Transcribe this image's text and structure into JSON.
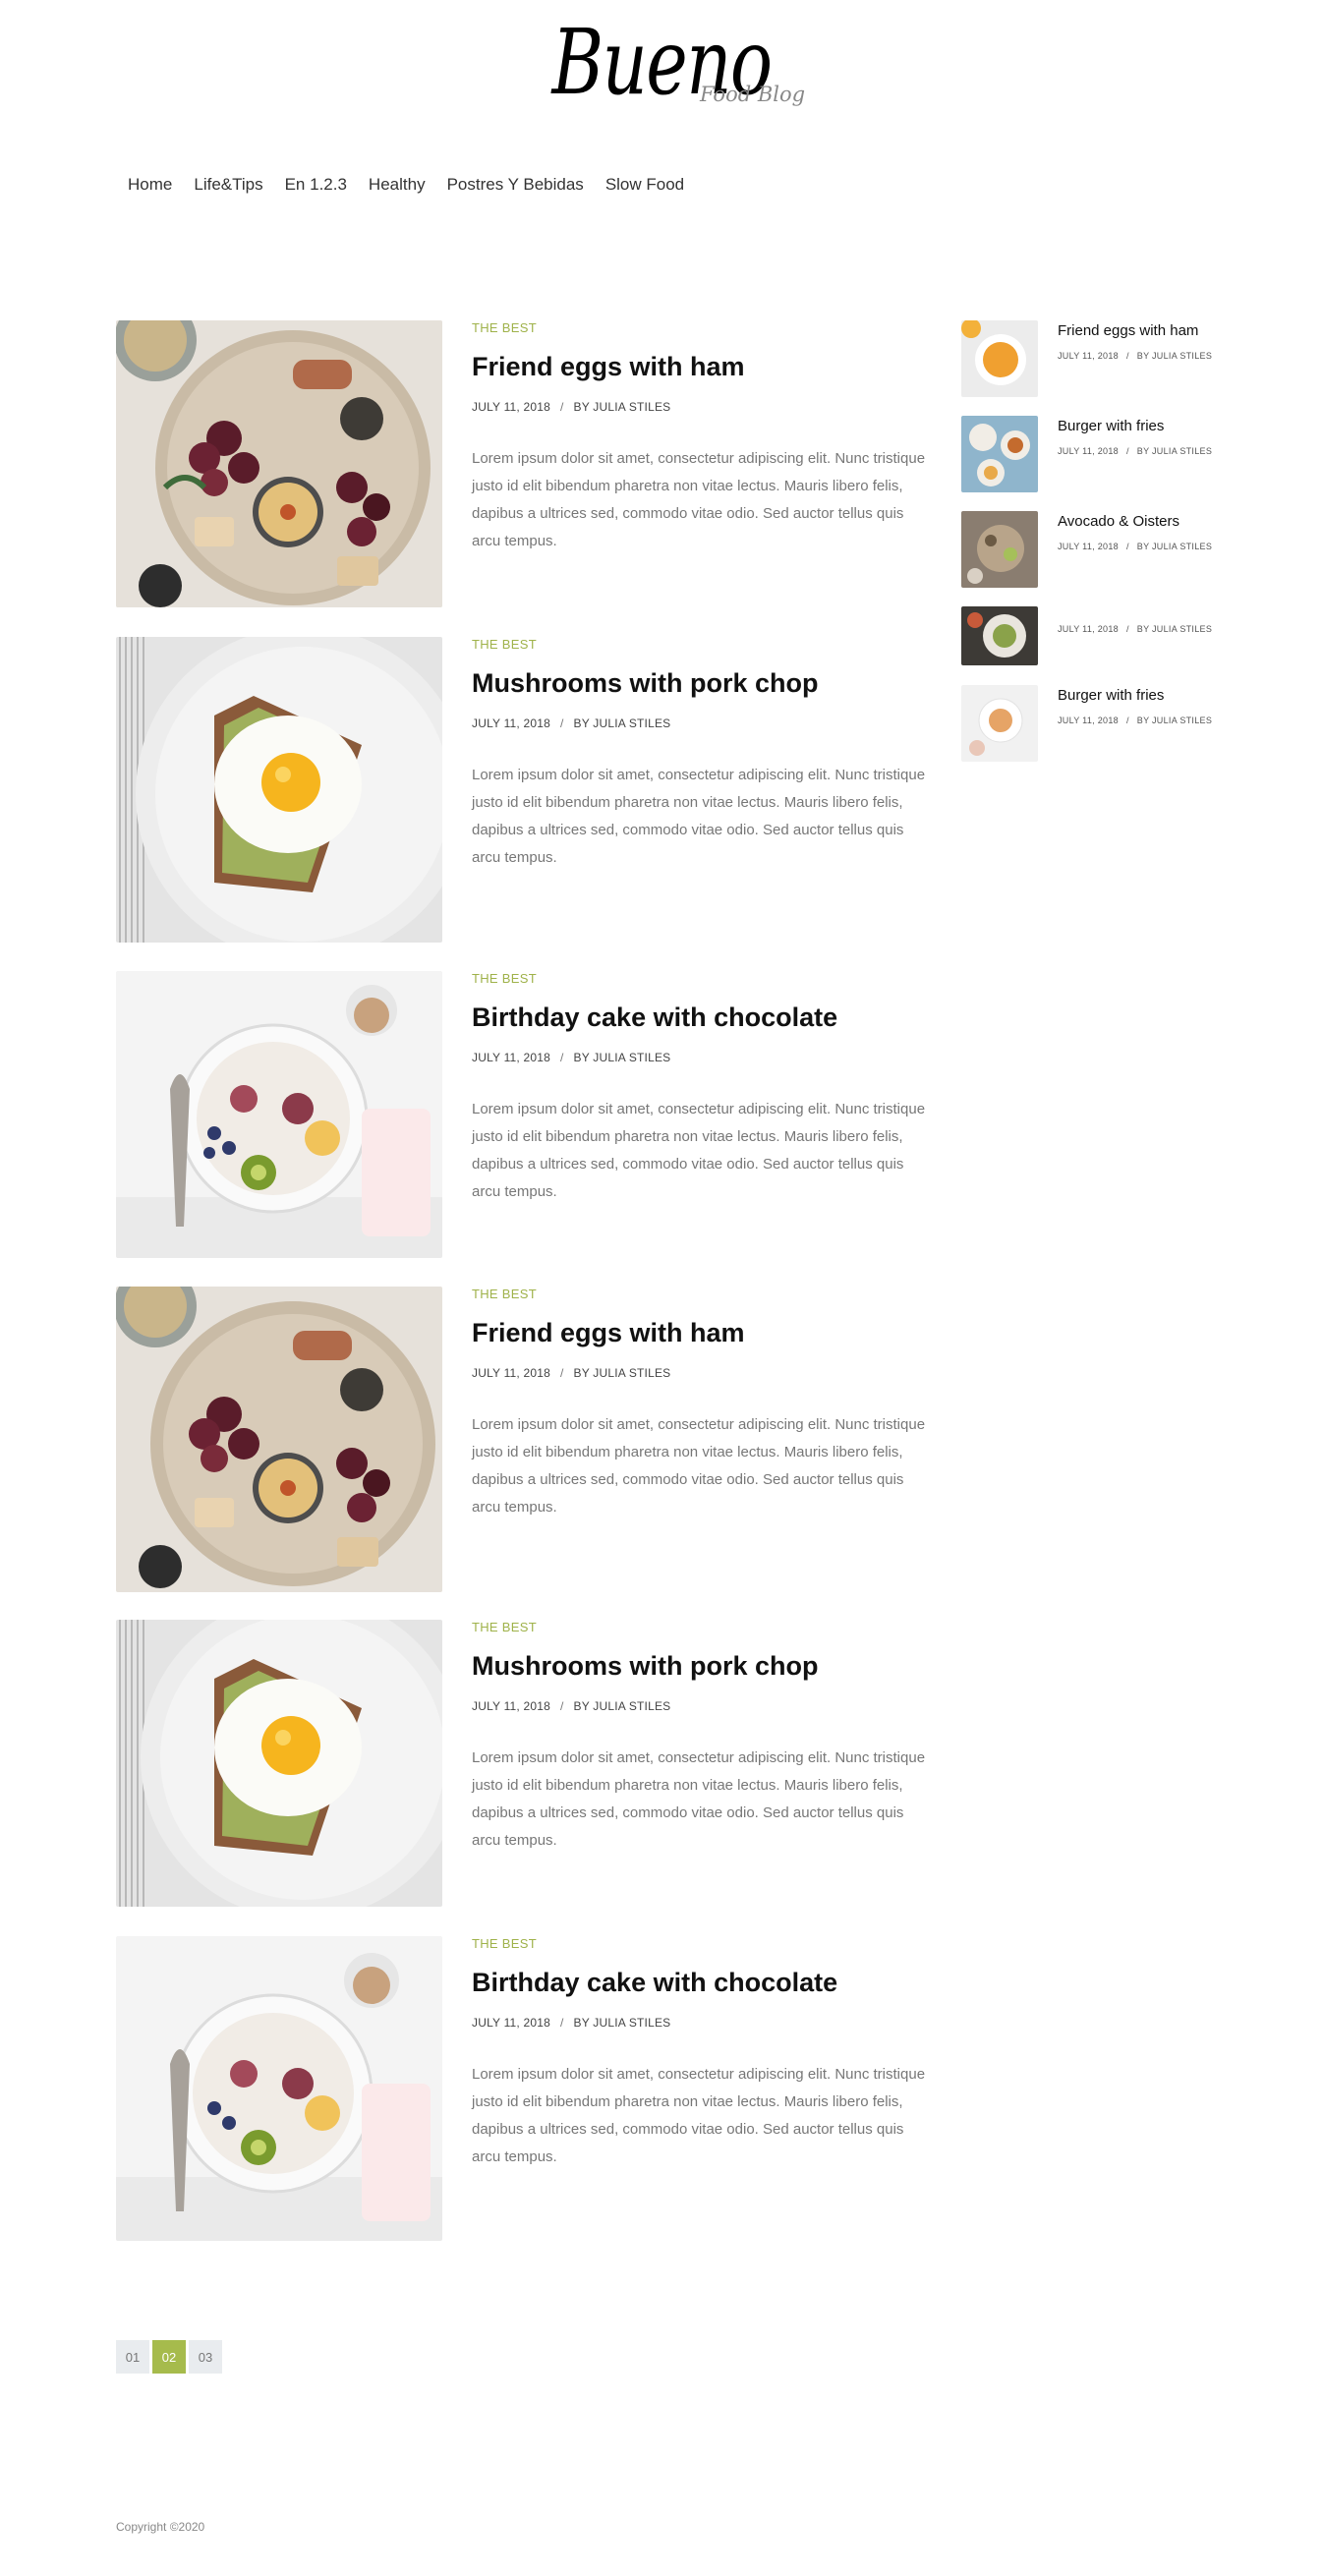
{
  "header": {
    "logo": "Bueno",
    "logo_sub": "Food Blog"
  },
  "nav": [
    "Home",
    "Life&Tips",
    "En 1.2.3",
    "Healthy",
    "Postres Y Bebidas",
    "Slow Food"
  ],
  "posts": [
    {
      "category": "THE BEST",
      "title": "Friend eggs with ham",
      "date": "JULY 11, 2018",
      "sep": "/",
      "author": "BY JULIA STILES",
      "excerpt": "Lorem ipsum dolor sit amet, consectetur adipiscing elit. Nunc tristique justo id elit bibendum pharetra non vitae lectus. Mauris libero felis, dapibus a ultrices sed, commodo vitae odio. Sed auctor tellus quis arcu tempus."
    },
    {
      "category": "THE BEST",
      "title": "Mushrooms with pork chop",
      "date": "JULY 11, 2018",
      "sep": "/",
      "author": "BY JULIA STILES",
      "excerpt": "Lorem ipsum dolor sit amet, consectetur adipiscing elit. Nunc tristique justo id elit bibendum pharetra non vitae lectus. Mauris libero felis, dapibus a ultrices sed, commodo vitae odio. Sed auctor tellus quis arcu tempus."
    },
    {
      "category": "THE BEST",
      "title": "Birthday cake with chocolate",
      "date": "JULY 11, 2018",
      "sep": "/",
      "author": "BY JULIA STILES",
      "excerpt": "Lorem ipsum dolor sit amet, consectetur adipiscing elit. Nunc tristique justo id elit bibendum pharetra non vitae lectus. Mauris libero felis, dapibus a ultrices sed, commodo vitae odio. Sed auctor tellus quis arcu tempus."
    },
    {
      "category": "THE BEST",
      "title": "Friend eggs with ham",
      "date": "JULY 11, 2018",
      "sep": "/",
      "author": "BY JULIA STILES",
      "excerpt": "Lorem ipsum dolor sit amet, consectetur adipiscing elit. Nunc tristique justo id elit bibendum pharetra non vitae lectus. Mauris libero felis, dapibus a ultrices sed, commodo vitae odio. Sed auctor tellus quis arcu tempus."
    },
    {
      "category": "THE BEST",
      "title": "Mushrooms with pork chop",
      "date": "JULY 11, 2018",
      "sep": "/",
      "author": "BY JULIA STILES",
      "excerpt": "Lorem ipsum dolor sit amet, consectetur adipiscing elit. Nunc tristique justo id elit bibendum pharetra non vitae lectus. Mauris libero felis, dapibus a ultrices sed, commodo vitae odio. Sed auctor tellus quis arcu tempus."
    },
    {
      "category": "THE BEST",
      "title": "Birthday cake with chocolate",
      "date": "JULY 11, 2018",
      "sep": "/",
      "author": "BY JULIA STILES",
      "excerpt": "Lorem ipsum dolor sit amet, consectetur adipiscing elit. Nunc tristique justo id elit bibendum pharetra non vitae lectus. Mauris libero felis, dapibus a ultrices sed, commodo vitae odio. Sed auctor tellus quis arcu tempus."
    }
  ],
  "sidebar": [
    {
      "title": "Friend eggs with ham",
      "date": "JULY 11, 2018",
      "sep": "/",
      "author": "BY JULIA STILES"
    },
    {
      "title": "Burger with fries",
      "date": "JULY 11, 2018",
      "sep": "/",
      "author": "BY JULIA STILES"
    },
    {
      "title": "Avocado & Oisters",
      "date": "JULY 11, 2018",
      "sep": "/",
      "author": "BY JULIA STILES"
    },
    {
      "title": "",
      "date": "JULY 11, 2018",
      "sep": "/",
      "author": "BY JULIA STILES"
    },
    {
      "title": "Burger with fries",
      "date": "JULY 11, 2018",
      "sep": "/",
      "author": "BY JULIA STILES"
    }
  ],
  "pagination": {
    "pages": [
      "01",
      "02",
      "03"
    ],
    "current": "02"
  },
  "footer": {
    "copyright": "Copyright ©2020"
  },
  "colors": {
    "accent": "#a6bb4c",
    "category": "#9fb24a"
  }
}
